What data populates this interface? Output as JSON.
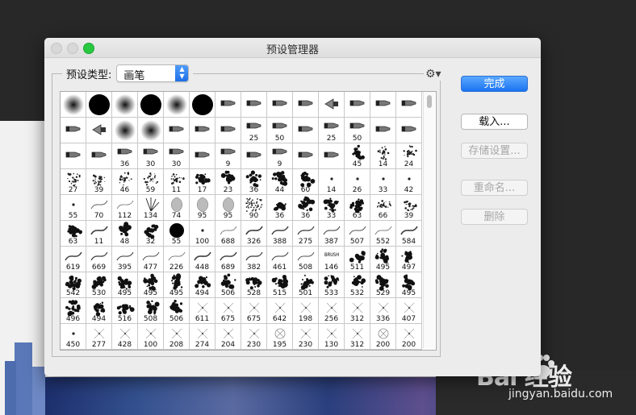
{
  "window": {
    "title": "预设管理器"
  },
  "preset_type": {
    "label": "预设类型:",
    "value": "画笔"
  },
  "buttons": {
    "done": "完成",
    "load": "载入...",
    "save": "存储设置...",
    "rename": "重命名...",
    "delete": "删除"
  },
  "colors": {
    "accent": "#1b74f0",
    "maximize": "#28c940"
  },
  "brushes": [
    {
      "icon": "soft-round",
      "n": ""
    },
    {
      "icon": "hard-round",
      "n": ""
    },
    {
      "icon": "soft-round",
      "n": ""
    },
    {
      "icon": "hard-round",
      "n": ""
    },
    {
      "icon": "soft-round",
      "n": ""
    },
    {
      "icon": "hard-round",
      "n": ""
    },
    {
      "icon": "tool-tip",
      "n": ""
    },
    {
      "icon": "tool-tip",
      "n": ""
    },
    {
      "icon": "tool-tip",
      "n": ""
    },
    {
      "icon": "tool-tip",
      "n": ""
    },
    {
      "icon": "tool-fan",
      "n": ""
    },
    {
      "icon": "tool-tip",
      "n": ""
    },
    {
      "icon": "tool-tip",
      "n": ""
    },
    {
      "icon": "tool-tip",
      "n": ""
    },
    {
      "icon": "tool-tip",
      "n": ""
    },
    {
      "icon": "tool-fan",
      "n": ""
    },
    {
      "icon": "soft-round",
      "n": ""
    },
    {
      "icon": "soft-round",
      "n": ""
    },
    {
      "icon": "tool-tip",
      "n": ""
    },
    {
      "icon": "tool-tip",
      "n": ""
    },
    {
      "icon": "tool-tip",
      "n": ""
    },
    {
      "icon": "tool-tip",
      "n": "25"
    },
    {
      "icon": "tool-tip",
      "n": "50"
    },
    {
      "icon": "tool-tip",
      "n": ""
    },
    {
      "icon": "tool-tip",
      "n": "25"
    },
    {
      "icon": "tool-tip",
      "n": "50"
    },
    {
      "icon": "tool-tip",
      "n": ""
    },
    {
      "icon": "tool-tip",
      "n": ""
    },
    {
      "icon": "tool-tip",
      "n": ""
    },
    {
      "icon": "tool-tip",
      "n": ""
    },
    {
      "icon": "tool-tip",
      "n": "36"
    },
    {
      "icon": "tool-tip",
      "n": "30"
    },
    {
      "icon": "tool-tip",
      "n": "30"
    },
    {
      "icon": "tool-tip",
      "n": ""
    },
    {
      "icon": "tool-tip",
      "n": "9"
    },
    {
      "icon": "tool-tip",
      "n": ""
    },
    {
      "icon": "tool-tip",
      "n": "9"
    },
    {
      "icon": "tool-tip",
      "n": ""
    },
    {
      "icon": "tool-tip",
      "n": ""
    },
    {
      "icon": "splatter",
      "n": "45"
    },
    {
      "icon": "scatter",
      "n": "14"
    },
    {
      "icon": "scatter",
      "n": "24"
    },
    {
      "icon": "scatter",
      "n": "27"
    },
    {
      "icon": "scatter",
      "n": "39"
    },
    {
      "icon": "scatter",
      "n": "46"
    },
    {
      "icon": "scatter",
      "n": "59"
    },
    {
      "icon": "scatter",
      "n": "11"
    },
    {
      "icon": "splatter",
      "n": "17"
    },
    {
      "icon": "splatter",
      "n": "23"
    },
    {
      "icon": "splatter",
      "n": "36"
    },
    {
      "icon": "splatter",
      "n": "44"
    },
    {
      "icon": "splatter",
      "n": "60"
    },
    {
      "icon": "dot",
      "n": "14"
    },
    {
      "icon": "dot",
      "n": "26"
    },
    {
      "icon": "dot",
      "n": "33"
    },
    {
      "icon": "dot",
      "n": "42"
    },
    {
      "icon": "dot",
      "n": "55"
    },
    {
      "icon": "stroke",
      "n": "70"
    },
    {
      "icon": "stroke",
      "n": "112"
    },
    {
      "icon": "grass",
      "n": "134"
    },
    {
      "icon": "leaf",
      "n": "74"
    },
    {
      "icon": "leaf",
      "n": "95"
    },
    {
      "icon": "leaf",
      "n": "95"
    },
    {
      "icon": "texture",
      "n": "90"
    },
    {
      "icon": "splatter",
      "n": "36"
    },
    {
      "icon": "splatter",
      "n": "36"
    },
    {
      "icon": "splatter",
      "n": "33"
    },
    {
      "icon": "splatter",
      "n": "63"
    },
    {
      "icon": "scatter",
      "n": "66"
    },
    {
      "icon": "scatter",
      "n": "39"
    },
    {
      "icon": "splatter",
      "n": "63"
    },
    {
      "icon": "stroke",
      "n": "11"
    },
    {
      "icon": "splatter",
      "n": "48"
    },
    {
      "icon": "splatter",
      "n": "32"
    },
    {
      "icon": "hard-round",
      "n": "55"
    },
    {
      "icon": "dot",
      "n": "100"
    },
    {
      "icon": "stroke",
      "n": "688"
    },
    {
      "icon": "stroke",
      "n": "326"
    },
    {
      "icon": "stroke",
      "n": "388"
    },
    {
      "icon": "stroke",
      "n": "275"
    },
    {
      "icon": "stroke",
      "n": "387"
    },
    {
      "icon": "stroke",
      "n": "507"
    },
    {
      "icon": "stroke",
      "n": "552"
    },
    {
      "icon": "stroke",
      "n": "584"
    },
    {
      "icon": "stroke",
      "n": "619"
    },
    {
      "icon": "stroke",
      "n": "669"
    },
    {
      "icon": "stroke",
      "n": "395"
    },
    {
      "icon": "stroke",
      "n": "477"
    },
    {
      "icon": "stroke",
      "n": "226"
    },
    {
      "icon": "stroke",
      "n": "448"
    },
    {
      "icon": "stroke",
      "n": "689"
    },
    {
      "icon": "stroke",
      "n": "382"
    },
    {
      "icon": "stroke",
      "n": "461"
    },
    {
      "icon": "stroke",
      "n": "508"
    },
    {
      "icon": "text-brush",
      "n": "146"
    },
    {
      "icon": "splatter",
      "n": "511"
    },
    {
      "icon": "splatter",
      "n": "495"
    },
    {
      "icon": "splatter",
      "n": "497"
    },
    {
      "icon": "splatter",
      "n": "542"
    },
    {
      "icon": "splatter",
      "n": "530"
    },
    {
      "icon": "splatter",
      "n": "495"
    },
    {
      "icon": "splatter",
      "n": "495"
    },
    {
      "icon": "splatter",
      "n": "495"
    },
    {
      "icon": "splatter",
      "n": "494"
    },
    {
      "icon": "splatter",
      "n": "506"
    },
    {
      "icon": "splatter",
      "n": "528"
    },
    {
      "icon": "splatter",
      "n": "515"
    },
    {
      "icon": "splatter",
      "n": "501"
    },
    {
      "icon": "splatter",
      "n": "533"
    },
    {
      "icon": "splatter",
      "n": "532"
    },
    {
      "icon": "splatter",
      "n": "529"
    },
    {
      "icon": "splatter",
      "n": "495"
    },
    {
      "icon": "splatter",
      "n": "496"
    },
    {
      "icon": "splatter",
      "n": "494"
    },
    {
      "icon": "splatter",
      "n": "516"
    },
    {
      "icon": "splatter",
      "n": "508"
    },
    {
      "icon": "splatter",
      "n": "506"
    },
    {
      "icon": "sparkle",
      "n": "611"
    },
    {
      "icon": "sparkle",
      "n": "675"
    },
    {
      "icon": "sparkle",
      "n": "675"
    },
    {
      "icon": "sparkle",
      "n": "642"
    },
    {
      "icon": "sparkle",
      "n": "198"
    },
    {
      "icon": "sparkle",
      "n": "256"
    },
    {
      "icon": "sparkle",
      "n": "312"
    },
    {
      "icon": "sparkle",
      "n": "336"
    },
    {
      "icon": "sparkle",
      "n": "407"
    },
    {
      "icon": "dot",
      "n": "450"
    },
    {
      "icon": "sparkle",
      "n": "277"
    },
    {
      "icon": "sparkle",
      "n": "428"
    },
    {
      "icon": "sparkle",
      "n": "100"
    },
    {
      "icon": "sparkle",
      "n": "208"
    },
    {
      "icon": "sparkle",
      "n": "274"
    },
    {
      "icon": "sparkle",
      "n": "204"
    },
    {
      "icon": "sparkle",
      "n": "230"
    },
    {
      "icon": "circle-cross",
      "n": "195"
    },
    {
      "icon": "sparkle",
      "n": "230"
    },
    {
      "icon": "sparkle",
      "n": "130"
    },
    {
      "icon": "sparkle",
      "n": "312"
    },
    {
      "icon": "circle-cross",
      "n": "200"
    },
    {
      "icon": "sparkle",
      "n": "200"
    }
  ],
  "watermark": {
    "brand": "Bai  经验",
    "url": "jingyan.baidu.com"
  }
}
